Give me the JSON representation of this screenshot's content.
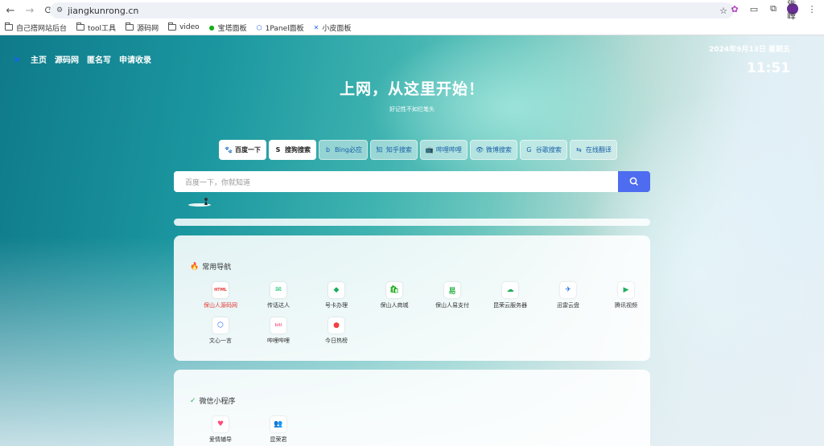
{
  "browser": {
    "url": "jiangkunrong.cn",
    "back": "←",
    "forward": "→",
    "reload": "⟳",
    "star": "☆",
    "avatar_text": "张峰"
  },
  "bookmarks": [
    {
      "label": "自己搭网站后台",
      "icon": "folder-icon"
    },
    {
      "label": "tool工具",
      "icon": "folder-icon"
    },
    {
      "label": "源码网",
      "icon": "folder-icon"
    },
    {
      "label": "video",
      "icon": "folder-icon"
    },
    {
      "label": "宝塔面板",
      "icon": "baota-icon"
    },
    {
      "label": "1Panel面板",
      "icon": "1panel-icon"
    },
    {
      "label": "小皮面板",
      "icon": "xp-icon"
    }
  ],
  "nav": {
    "items": [
      "主页",
      "源码网",
      "匿名写",
      "申请收录"
    ]
  },
  "clock": {
    "date": "2024年9月13日 星期五",
    "time": "11:51"
  },
  "hero": {
    "title": "上网，从这里开始！",
    "subtitle": "好记性不如烂笔头"
  },
  "engines": [
    {
      "label": "百度一下",
      "icon": "🐾",
      "active": true
    },
    {
      "label": "搜狗搜索",
      "icon": "S",
      "active": true
    },
    {
      "label": "Bing必应",
      "icon": "b",
      "active": false
    },
    {
      "label": "知乎搜索",
      "icon": "知",
      "active": false
    },
    {
      "label": "哔哩哔哩",
      "icon": "📺",
      "active": false
    },
    {
      "label": "微博搜索",
      "icon": "👁",
      "active": false
    },
    {
      "label": "谷歌搜索",
      "icon": "G",
      "active": false
    },
    {
      "label": "在线翻译",
      "icon": "⇆",
      "active": false
    }
  ],
  "search": {
    "placeholder": "百度一下，你就知道"
  },
  "sections": [
    {
      "title": "常用导航",
      "items": [
        {
          "label": "保山人源码网",
          "glyph": "HTML",
          "color": "#e53935",
          "red": true
        },
        {
          "label": "传话达人",
          "glyph": "✉",
          "color": "#07c160"
        },
        {
          "label": "号卡办理",
          "glyph": "◆",
          "color": "#1aad5a"
        },
        {
          "label": "保山人商城",
          "glyph": "🛍",
          "color": "#1aad19"
        },
        {
          "label": "保山人易支付",
          "glyph": "易",
          "color": "#2bb24c"
        },
        {
          "label": "昆荣云服务器",
          "glyph": "☁",
          "color": "#1aad5a"
        },
        {
          "label": "迅雷云盘",
          "glyph": "✈",
          "color": "#1f6fe0"
        },
        {
          "label": "腾讯视频",
          "glyph": "▶",
          "color": "#20b060"
        },
        {
          "label": "文心一言",
          "glyph": "⬡",
          "color": "#2468f2"
        },
        {
          "label": "哔哩哔哩",
          "glyph": "bili",
          "color": "#fb7299"
        },
        {
          "label": "今日热榜",
          "glyph": "●",
          "color": "#f04040"
        }
      ]
    },
    {
      "title": "微信小程序",
      "items": [
        {
          "label": "爱情辅导",
          "glyph": "♥",
          "color": "#ff4d7a"
        },
        {
          "label": "昆荣君",
          "glyph": "👥",
          "color": "#8a6a50"
        }
      ]
    }
  ],
  "colors": {
    "accent": "#4d6cf0",
    "nav_red": "#e53935"
  }
}
